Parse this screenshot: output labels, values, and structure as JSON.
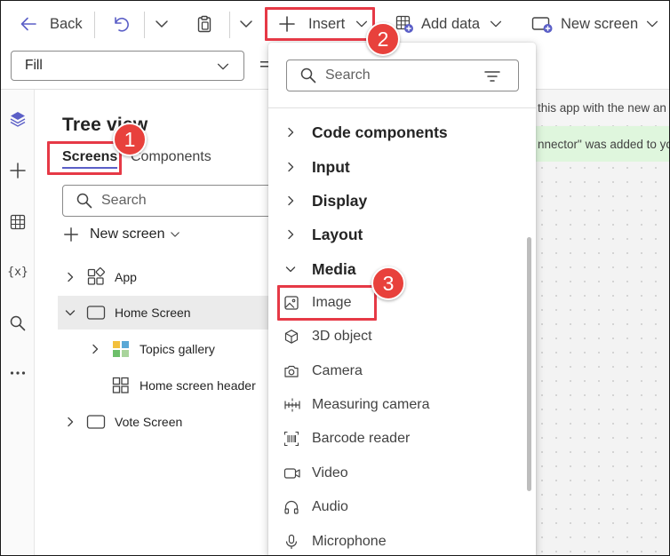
{
  "toolbar": {
    "back_label": "Back",
    "insert_label": "Insert",
    "add_data_label": "Add data",
    "new_screen_label": "New screen"
  },
  "formula_bar": {
    "property": "Fill",
    "equals": "="
  },
  "tree": {
    "title": "Tree view",
    "tabs": [
      "Screens",
      "Components"
    ],
    "search_placeholder": "Search",
    "new_screen_label": "New screen",
    "nodes": [
      "App",
      "Home Screen",
      "Topics gallery",
      "Home screen header",
      "Vote Screen"
    ]
  },
  "canvas": {
    "notice_1": "this app with the new an",
    "notice_2": "nnector\" was added to yo"
  },
  "insert_menu": {
    "search_placeholder": "Search",
    "categories": [
      "Code components",
      "Input",
      "Display",
      "Layout",
      "Media"
    ],
    "media_items": [
      "Image",
      "3D object",
      "Camera",
      "Measuring camera",
      "Barcode reader",
      "Video",
      "Audio",
      "Microphone"
    ]
  },
  "annotations": [
    "1",
    "2",
    "3"
  ],
  "colors": {
    "highlight": "#e63946",
    "badge": "#e8413c",
    "accent": "#5b5fc7",
    "success_bar": "#dff6dd"
  }
}
